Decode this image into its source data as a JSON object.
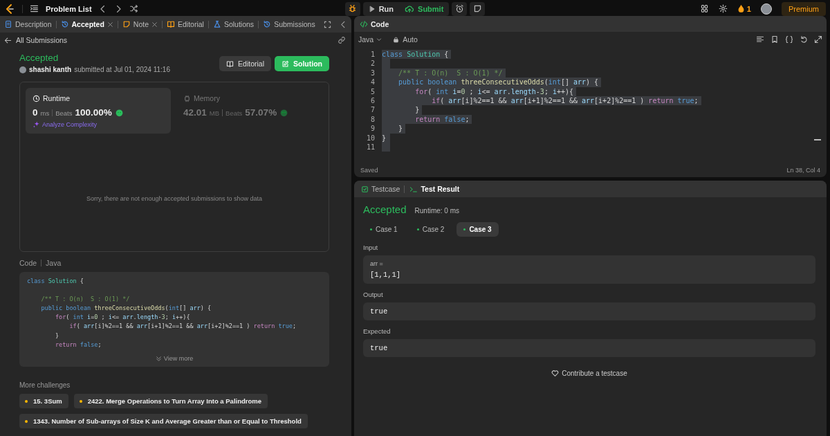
{
  "top_bar": {
    "problem_list": "Problem List",
    "run": "Run",
    "submit": "Submit",
    "streak": "1",
    "premium": "Premium"
  },
  "left_panel": {
    "tabs": [
      {
        "label": "Description",
        "kind": "description",
        "selected": false,
        "closable": false
      },
      {
        "label": "Accepted",
        "kind": "accepted",
        "selected": true,
        "closable": true
      },
      {
        "label": "Note",
        "kind": "note",
        "selected": false,
        "closable": true
      },
      {
        "label": "Editorial",
        "kind": "editorial",
        "selected": false,
        "closable": false
      },
      {
        "label": "Solutions",
        "kind": "solutions",
        "selected": false,
        "closable": false
      },
      {
        "label": "Submissions",
        "kind": "submissions",
        "selected": false,
        "closable": false
      }
    ],
    "back_link": "All Submissions",
    "submission": {
      "status": "Accepted",
      "user": "shashi kanth",
      "submitted": "submitted at Jul 01, 2024 11:16"
    },
    "actions": [
      {
        "label": "Editorial",
        "kind": "editorial"
      },
      {
        "label": "Solution",
        "kind": "solution"
      }
    ],
    "stats": [
      {
        "kind": "runtime",
        "label": "Runtime",
        "value": "0",
        "unit": "ms",
        "beats_label": "Beats",
        "beats": "100.00%",
        "selected": true,
        "link": "Analyze Complexity"
      },
      {
        "kind": "memory",
        "label": "Memory",
        "value": "42.01",
        "unit": "MB",
        "beats_label": "Beats",
        "beats": "57.07%",
        "selected": false
      }
    ],
    "chart_message": "Sorry, there are not enough accepted submissions to show data",
    "code_header": {
      "title": "Code",
      "language": "Java"
    },
    "code_lines": [
      {
        "tokens": [
          {
            "kind": "keyword",
            "text": "class"
          },
          {
            "kind": "type",
            "text": " Solution"
          },
          {
            "kind": "plain",
            "text": " {"
          }
        ]
      },
      {
        "blank_before": true,
        "tokens": [
          {
            "kind": "comment",
            "text": "    /** T : O(n)  S : O(1) */"
          }
        ]
      },
      {
        "tokens": [
          {
            "kind": "keyword",
            "text": "    public boolean "
          },
          {
            "kind": "function",
            "text": "threeConsecutiveOdds"
          },
          {
            "kind": "plain",
            "text": "("
          },
          {
            "kind": "keyword",
            "text": "int"
          },
          {
            "kind": "plain",
            "text": "[] "
          },
          {
            "kind": "variable",
            "text": "arr"
          },
          {
            "kind": "plain",
            "text": ") {"
          }
        ]
      },
      {
        "tokens": [
          {
            "kind": "control",
            "text": "        for"
          },
          {
            "kind": "plain",
            "text": "( "
          },
          {
            "kind": "keyword",
            "text": "int"
          },
          {
            "kind": "variable",
            "text": " i"
          },
          {
            "kind": "plain",
            "text": "="
          },
          {
            "kind": "number",
            "text": "0"
          },
          {
            "kind": "plain",
            "text": " ; "
          },
          {
            "kind": "variable",
            "text": "i"
          },
          {
            "kind": "plain",
            "text": "<= "
          },
          {
            "kind": "variable",
            "text": "arr"
          },
          {
            "kind": "plain",
            "text": "."
          },
          {
            "kind": "variable",
            "text": "length"
          },
          {
            "kind": "plain",
            "text": "-"
          },
          {
            "kind": "number",
            "text": "3"
          },
          {
            "kind": "plain",
            "text": "; "
          },
          {
            "kind": "variable",
            "text": "i"
          },
          {
            "kind": "plain",
            "text": "++){"
          }
        ]
      },
      {
        "tokens": [
          {
            "kind": "control",
            "text": "            if"
          },
          {
            "kind": "plain",
            "text": "( "
          },
          {
            "kind": "variable",
            "text": "arr"
          },
          {
            "kind": "plain",
            "text": "[i]%2==1 && "
          },
          {
            "kind": "variable",
            "text": "arr"
          },
          {
            "kind": "plain",
            "text": "[i+1]%2==1 && "
          },
          {
            "kind": "variable",
            "text": "arr"
          },
          {
            "kind": "plain",
            "text": "[i+2]%2==1 ) "
          },
          {
            "kind": "control",
            "text": "return"
          },
          {
            "kind": "keyword",
            "text": " true"
          },
          {
            "kind": "plain",
            "text": ";"
          }
        ]
      },
      {
        "tokens": [
          {
            "kind": "plain",
            "text": "        }"
          }
        ]
      },
      {
        "tokens": [
          {
            "kind": "control",
            "text": "        return"
          },
          {
            "kind": "keyword",
            "text": " false"
          },
          {
            "kind": "plain",
            "text": ";"
          }
        ]
      }
    ],
    "view_more": "View more",
    "more_challenges": {
      "title": "More challenges",
      "items": [
        {
          "label": "15. 3Sum",
          "color": "#ffb800"
        },
        {
          "label": "2422. Merge Operations to Turn Array Into a Palindrome",
          "color": "#ffb800"
        },
        {
          "label": "1343. Number of Sub-arrays of Size K and Average Greater than or Equal to Threshold",
          "color": "#ffb800"
        }
      ]
    }
  },
  "editor": {
    "title": "Code",
    "language": "Java",
    "mode": "Auto",
    "lines": [
      {
        "number": "1",
        "selected": true,
        "tokens": [
          {
            "kind": "keyword",
            "text": "class"
          },
          {
            "kind": "type",
            "text": " Solution"
          },
          {
            "kind": "plain",
            "text": " {"
          }
        ]
      },
      {
        "number": "2",
        "selected": true
      },
      {
        "number": "3",
        "selected": true,
        "tokens": [
          {
            "kind": "comment",
            "text": "    /** T : O(n)  S : O(1) */"
          }
        ]
      },
      {
        "number": "4",
        "selected": true,
        "tokens": [
          {
            "kind": "keyword",
            "text": "    public boolean "
          },
          {
            "kind": "function",
            "text": "threeConsecutiveOdds"
          },
          {
            "kind": "plain",
            "text": "("
          },
          {
            "kind": "keyword",
            "text": "int"
          },
          {
            "kind": "plain",
            "text": "[] "
          },
          {
            "kind": "variable",
            "text": "arr"
          },
          {
            "kind": "plain",
            "text": ") {"
          }
        ]
      },
      {
        "number": "5",
        "selected": true,
        "tokens": [
          {
            "kind": "control",
            "text": "        for"
          },
          {
            "kind": "plain",
            "text": "( "
          },
          {
            "kind": "keyword",
            "text": "int"
          },
          {
            "kind": "variable",
            "text": " i"
          },
          {
            "kind": "plain",
            "text": "="
          },
          {
            "kind": "number",
            "text": "0"
          },
          {
            "kind": "plain",
            "text": " ; "
          },
          {
            "kind": "variable",
            "text": "i"
          },
          {
            "kind": "plain",
            "text": "<= "
          },
          {
            "kind": "variable",
            "text": "arr"
          },
          {
            "kind": "plain",
            "text": "."
          },
          {
            "kind": "variable",
            "text": "length"
          },
          {
            "kind": "plain",
            "text": "-"
          },
          {
            "kind": "number",
            "text": "3"
          },
          {
            "kind": "plain",
            "text": "; "
          },
          {
            "kind": "variable",
            "text": "i"
          },
          {
            "kind": "plain",
            "text": "++){"
          }
        ]
      },
      {
        "number": "6",
        "selected": true,
        "tokens": [
          {
            "kind": "control",
            "text": "            if"
          },
          {
            "kind": "plain",
            "text": "( "
          },
          {
            "kind": "variable",
            "text": "arr"
          },
          {
            "kind": "plain",
            "text": "[i]%2==1 && "
          },
          {
            "kind": "variable",
            "text": "arr"
          },
          {
            "kind": "plain",
            "text": "[i+1]%2==1 && "
          },
          {
            "kind": "variable",
            "text": "arr"
          },
          {
            "kind": "plain",
            "text": "[i+2]%2==1 ) "
          },
          {
            "kind": "control",
            "text": "return"
          },
          {
            "kind": "keyword",
            "text": " true"
          },
          {
            "kind": "plain",
            "text": ";"
          }
        ]
      },
      {
        "number": "7",
        "selected": true,
        "tokens": [
          {
            "kind": "plain",
            "text": "        }"
          }
        ]
      },
      {
        "number": "8",
        "selected": true,
        "tokens": [
          {
            "kind": "control",
            "text": "        return"
          },
          {
            "kind": "keyword",
            "text": " false"
          },
          {
            "kind": "plain",
            "text": ";"
          }
        ]
      },
      {
        "number": "9",
        "selected": true,
        "tokens": [
          {
            "kind": "plain",
            "text": "    }"
          }
        ]
      },
      {
        "number": "10",
        "selected": true,
        "tokens": [
          {
            "kind": "plain",
            "text": "}"
          }
        ]
      },
      {
        "number": "11",
        "selected": true
      }
    ],
    "status": "Saved",
    "cursor": "Ln 38, Col 4"
  },
  "result": {
    "tabs": [
      {
        "label": "Testcase",
        "kind": "testcase",
        "selected": false
      },
      {
        "label": "Test Result",
        "kind": "result",
        "selected": true
      }
    ],
    "status": "Accepted",
    "runtime": "Runtime: 0 ms",
    "cases": [
      {
        "label": "Case 1",
        "selected": false
      },
      {
        "label": "Case 2",
        "selected": false
      },
      {
        "label": "Case 3",
        "selected": true
      }
    ],
    "fields": [
      {
        "label": "Input",
        "name": "arr =",
        "value": "[1,1,1]"
      },
      {
        "label": "Output",
        "value": "true"
      },
      {
        "label": "Expected",
        "value": "true"
      }
    ],
    "contribute": "Contribute a testcase"
  }
}
